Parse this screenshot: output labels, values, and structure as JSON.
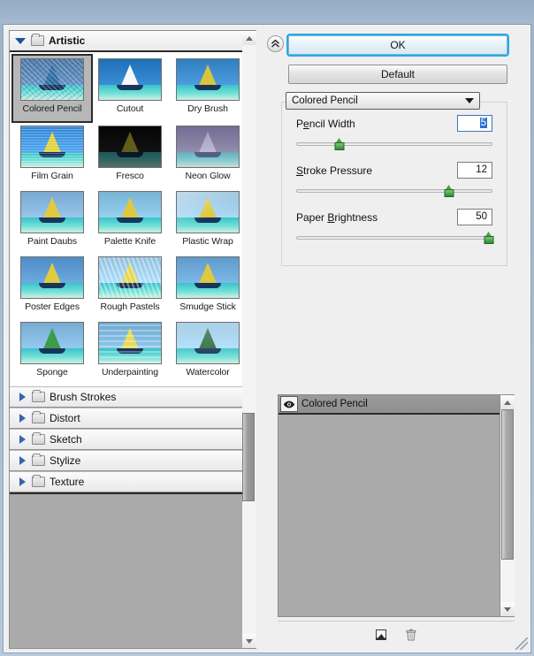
{
  "window": {
    "title": ""
  },
  "left_panel": {
    "category_header": {
      "label": "Artistic",
      "icon": "folder-icon",
      "expanded": true
    },
    "thumbnails": [
      {
        "label": "Colored Pencil",
        "selected": true,
        "sky": "#4a77a8",
        "sail": "#2e6ea8",
        "style": "pencil"
      },
      {
        "label": "Cutout",
        "selected": false,
        "sky": "#1d6fb8",
        "sail": "#f5f7fa",
        "style": "flat"
      },
      {
        "label": "Dry Brush",
        "selected": false,
        "sky": "#2f7fc0",
        "sail": "#d9c53a",
        "style": "soft"
      },
      {
        "label": "Film Grain",
        "selected": false,
        "sky": "#2f86d4",
        "sail": "#e0d23c",
        "style": "grain"
      },
      {
        "label": "Fresco",
        "selected": false,
        "sky": "#0b0b0b",
        "sail": "#d8cf3a",
        "style": "dark"
      },
      {
        "label": "Neon Glow",
        "selected": false,
        "sky": "#6d6a86",
        "sail": "#d8d8e4",
        "style": "glow"
      },
      {
        "label": "Paint Daubs",
        "selected": false,
        "sky": "#7aa9cf",
        "sail": "#e3c93f",
        "style": "daub"
      },
      {
        "label": "Palette Knife",
        "selected": false,
        "sky": "#79b3d4",
        "sail": "#dfc83f",
        "style": "knife"
      },
      {
        "label": "Plastic Wrap",
        "selected": false,
        "sky": "#8ebcd9",
        "sail": "#ddc63d",
        "style": "wrap"
      },
      {
        "label": "Poster Edges",
        "selected": false,
        "sky": "#4f8cc4",
        "sail": "#e2cb3f",
        "style": "poster"
      },
      {
        "label": "Rough Pastels",
        "selected": false,
        "sky": "#8fc0de",
        "sail": "#e8d64a",
        "style": "pastel"
      },
      {
        "label": "Smudge Stick",
        "selected": false,
        "sky": "#5e9bcb",
        "sail": "#dfc93e",
        "style": "smudge"
      },
      {
        "label": "Sponge",
        "selected": false,
        "sky": "#76abd2",
        "sail": "#3f9b4a",
        "style": "sponge"
      },
      {
        "label": "Underpainting",
        "selected": false,
        "sky": "#6fa9cf",
        "sail": "#e7da5c",
        "style": "under"
      },
      {
        "label": "Watercolor",
        "selected": false,
        "sky": "#8ec0dd",
        "sail": "#2d6b3b",
        "style": "water"
      }
    ],
    "tree_items": [
      {
        "label": "Brush Strokes",
        "expanded": false,
        "icon": "folder-icon"
      },
      {
        "label": "Distort",
        "expanded": false,
        "icon": "folder-icon"
      },
      {
        "label": "Sketch",
        "expanded": false,
        "icon": "folder-icon"
      },
      {
        "label": "Stylize",
        "expanded": false,
        "icon": "folder-icon"
      },
      {
        "label": "Texture",
        "expanded": false,
        "icon": "folder-icon"
      }
    ],
    "scrollbar": {
      "up_icon": "scroll-up-arrow-icon",
      "down_icon": "scroll-down-arrow-icon"
    }
  },
  "right_panel": {
    "collapse_button": {
      "icon": "double-chevron-up-icon"
    },
    "ok_label": "OK",
    "default_label": "Default",
    "filter_select": {
      "value": "Colored Pencil",
      "icon": "chevron-down-icon"
    },
    "parameters": [
      {
        "label_pre": "P",
        "label_key": "e",
        "label_post": "ncil Width",
        "label": "Pencil Width",
        "value": "5",
        "percent": 22,
        "focused": true
      },
      {
        "label_pre": "",
        "label_key": "S",
        "label_post": "troke Pressure",
        "label": "Stroke Pressure",
        "value": "12",
        "percent": 78,
        "focused": false
      },
      {
        "label_pre": "Paper ",
        "label_key": "B",
        "label_post": "rightness",
        "label": "Paper Brightness",
        "value": "50",
        "percent": 98,
        "focused": false
      }
    ],
    "layers": {
      "items": [
        {
          "name": "Colored Pencil",
          "visible": true,
          "eye_icon": "eye-icon"
        }
      ],
      "new_layer_icon": "new-effect-layer-icon",
      "delete_icon": "trash-icon"
    }
  },
  "colors": {
    "accent": "#29a9e8",
    "knob_green": "#2e8b33",
    "selection_blue": "#2f6fd0",
    "titlebar": "#9cb2c9",
    "panel_gray": "#aaaaaa"
  }
}
